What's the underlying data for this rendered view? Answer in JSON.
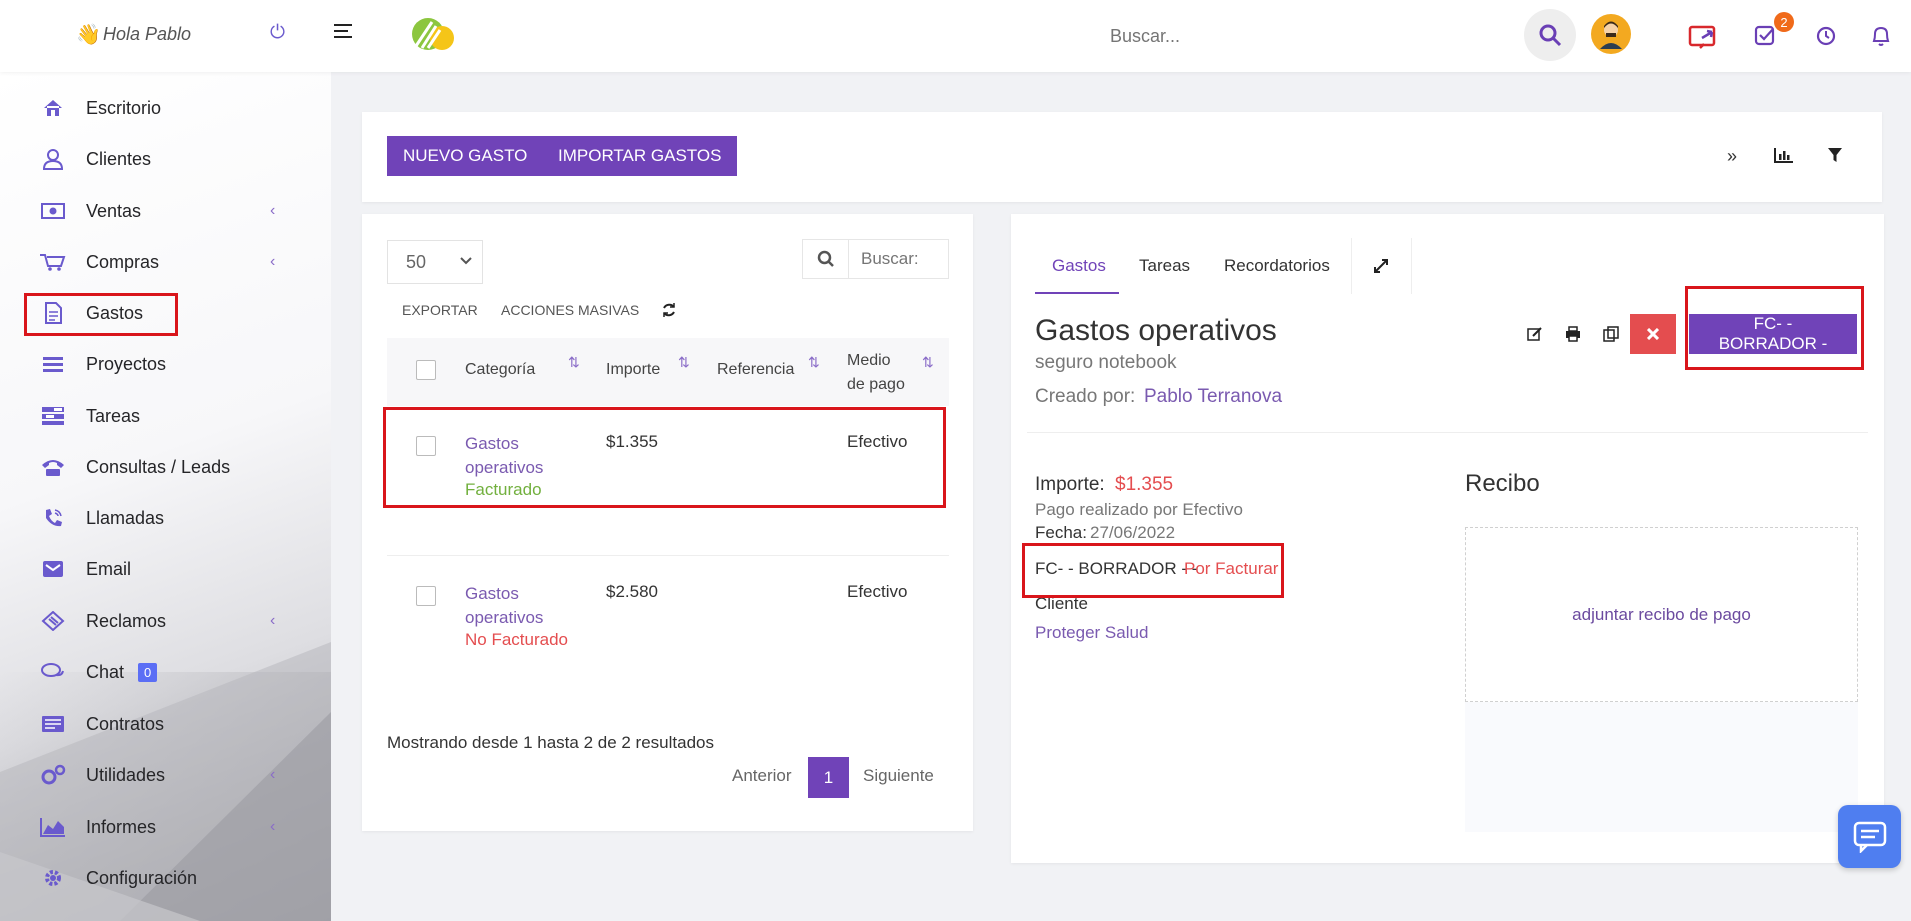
{
  "topbar": {
    "greeting": "Hola Pablo",
    "search_placeholder": "Buscar...",
    "tasks_badge": "2"
  },
  "sidebar": {
    "items": [
      {
        "label": "Escritorio",
        "icon": "home-icon"
      },
      {
        "label": "Clientes",
        "icon": "user-icon"
      },
      {
        "label": "Ventas",
        "icon": "money-icon"
      },
      {
        "label": "Compras",
        "icon": "cart-icon"
      },
      {
        "label": "Gastos",
        "icon": "document-icon"
      },
      {
        "label": "Proyectos",
        "icon": "bars-icon"
      },
      {
        "label": "Tareas",
        "icon": "tasks-icon"
      },
      {
        "label": "Consultas / Leads",
        "icon": "phone-icon"
      },
      {
        "label": "Llamadas",
        "icon": "phone-volume-icon"
      },
      {
        "label": "Email",
        "icon": "envelope-icon"
      },
      {
        "label": "Reclamos",
        "icon": "ticket-icon"
      },
      {
        "label": "Chat",
        "icon": "chat-icon",
        "badge": "0"
      },
      {
        "label": "Contratos",
        "icon": "contract-icon"
      },
      {
        "label": "Utilidades",
        "icon": "cogs-icon"
      },
      {
        "label": "Informes",
        "icon": "area-chart-icon"
      },
      {
        "label": "Configuración",
        "icon": "gear-icon"
      }
    ]
  },
  "toolbar": {
    "new_expense": "NUEVO GASTO",
    "import_expenses": "IMPORTAR GASTOS"
  },
  "list": {
    "page_size": "50",
    "search_placeholder": "Buscar:",
    "export": "EXPORTAR",
    "bulk_actions": "ACCIONES MASIVAS",
    "columns": [
      "Categoría",
      "Importe",
      "Referencia",
      "Medio de pago"
    ],
    "rows": [
      {
        "category": "Gastos operativos",
        "status": "Facturado",
        "amount": "$1.355",
        "reference": "",
        "payment": "Efectivo"
      },
      {
        "category": "Gastos operativos",
        "status": "No Facturado",
        "amount": "$2.580",
        "reference": "",
        "payment": "Efectivo"
      }
    ],
    "footer": "Mostrando desde 1 hasta 2 de 2 resultados",
    "prev": "Anterior",
    "page": "1",
    "next": "Siguiente"
  },
  "detail": {
    "tabs": [
      "Gastos",
      "Tareas",
      "Recordatorios"
    ],
    "title": "Gastos operativos",
    "subtitle": "seguro notebook",
    "created_by_label": "Creado por:",
    "created_by": "Pablo Terranova",
    "status_button": "FC- - BORRADOR -",
    "amount_label": "Importe:",
    "amount": "$1.355",
    "payment_text": "Pago realizado por Efectivo",
    "date_label": "Fecha:",
    "date": "27/06/2022",
    "invoice_text": "FC- - BORRADOR - -",
    "invoice_status": "Por Facturar",
    "client_label": "Cliente",
    "client": "Proteger Salud",
    "receipt_title": "Recibo",
    "receipt_drop": "adjuntar recibo de pago"
  },
  "colors": {
    "accent": "#7043b8",
    "danger": "#e44d4f",
    "success": "#72b03e",
    "highlight": "#d9151b"
  }
}
